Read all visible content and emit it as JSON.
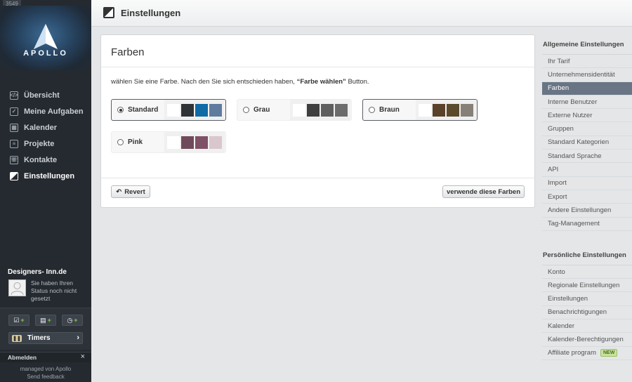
{
  "sidebar": {
    "counter": "3549",
    "logo_text": "APOLLO",
    "nav": [
      {
        "label": "Übersicht",
        "icon": "overview-icon",
        "glyph": "&lt;/&gt;",
        "active": false
      },
      {
        "label": "Meine Aufgaben",
        "icon": "checkbox-icon",
        "glyph": "✓",
        "active": false
      },
      {
        "label": "Kalender",
        "icon": "calendar-icon",
        "glyph": "▦",
        "active": false
      },
      {
        "label": "Projekte",
        "icon": "projects-icon",
        "glyph": "≡",
        "active": false
      },
      {
        "label": "Kontakte",
        "icon": "contacts-icon",
        "glyph": "☏",
        "active": false
      },
      {
        "label": "Einstellungen",
        "icon": "settings-icon",
        "glyph": "",
        "active": true
      }
    ],
    "user_name": "Designers- Inn.de",
    "user_status": "Sie haben Ihren Status noch nicht gesetzt",
    "timers_label": "Timers",
    "logout_label": "Abmelden",
    "footer_line1": "managed von Apollo",
    "footer_line2": "Send feedback"
  },
  "header": {
    "title": "Einstellungen"
  },
  "panel": {
    "title": "Farben",
    "instruction_prefix": "wählen Sie eine Farbe. Nach den Sie sich entschieden haben, ",
    "instruction_bold": "“Farbe wählen”",
    "instruction_suffix": " Button.",
    "options": [
      {
        "label": "Standard",
        "selected": true,
        "swatches": [
          "#ffffff",
          "#2f3338",
          "#0f6aa6",
          "#5f7c9e"
        ]
      },
      {
        "label": "Grau",
        "selected": false,
        "swatches": [
          "#ffffff",
          "#3f3f3f",
          "#5e5e5e",
          "#6c6c6c"
        ]
      },
      {
        "label": "Braun",
        "selected": false,
        "swatches": [
          "#ffffff",
          "#5a4129",
          "#5b4b2c",
          "#868078"
        ]
      },
      {
        "label": "Pink",
        "selected": false,
        "swatches": [
          "#ffffff",
          "#6f4a5a",
          "#7f5166",
          "#dac6cd"
        ]
      }
    ],
    "revert_label": "Revert",
    "apply_label": "verwende diese Farben"
  },
  "right_sidebar": {
    "general_heading": "Allgemeine Einstellungen",
    "general_items": [
      {
        "label": "Ihr Tarif",
        "active": false
      },
      {
        "label": "Unternehmensidentität",
        "active": false
      },
      {
        "label": "Farben",
        "active": true
      },
      {
        "label": "Interne Benutzer",
        "active": false
      },
      {
        "label": "Externe Nutzer",
        "active": false
      },
      {
        "label": "Gruppen",
        "active": false
      },
      {
        "label": "Standard Kategorien",
        "active": false
      },
      {
        "label": "Standard Sprache",
        "active": false
      },
      {
        "label": "API",
        "active": false
      },
      {
        "label": "Import",
        "active": false
      },
      {
        "label": "Export",
        "active": false
      },
      {
        "label": "Andere Einstellungen",
        "active": false
      },
      {
        "label": "Tag-Management",
        "active": false
      }
    ],
    "personal_heading": "Persönliche Einstellungen",
    "personal_items": [
      {
        "label": "Konto"
      },
      {
        "label": "Regionale Einstellungen"
      },
      {
        "label": "Einstellungen"
      },
      {
        "label": "Benachrichtigungen"
      },
      {
        "label": "Kalender"
      },
      {
        "label": "Kalender-Berechtigungen"
      },
      {
        "label": "Affiliate program",
        "badge": "NEW"
      }
    ]
  }
}
